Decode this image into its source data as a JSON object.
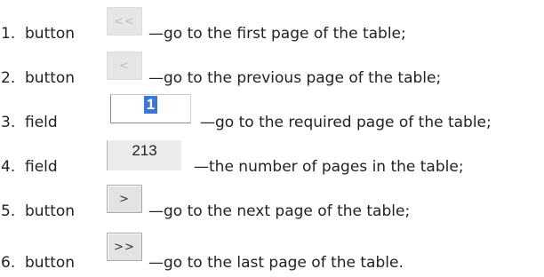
{
  "items": [
    {
      "number": "1.",
      "kind": "button",
      "control_label": "<<",
      "description": "—go to the first page of the table;"
    },
    {
      "number": "2.",
      "kind": "button",
      "control_label": "<",
      "description": "—go to the previous page of the table;"
    },
    {
      "number": "3.",
      "kind": "field",
      "control_value": "1",
      "description": "—go to the required page of the table;"
    },
    {
      "number": "4.",
      "kind": "field",
      "control_value": "213",
      "description": "—the number of pages in the table;"
    },
    {
      "number": "5.",
      "kind": "button",
      "control_label": ">",
      "description": "—go to the next page of the table;"
    },
    {
      "number": "6.",
      "kind": "button",
      "control_label": ">>",
      "description": "—go to the last page of the table."
    }
  ],
  "colors": {
    "selection_highlight": "#3b77d6",
    "disabled_button_bg": "#e6e6e6",
    "enabled_button_bg": "#e3e3e3",
    "readonly_field_bg": "#ececec"
  }
}
